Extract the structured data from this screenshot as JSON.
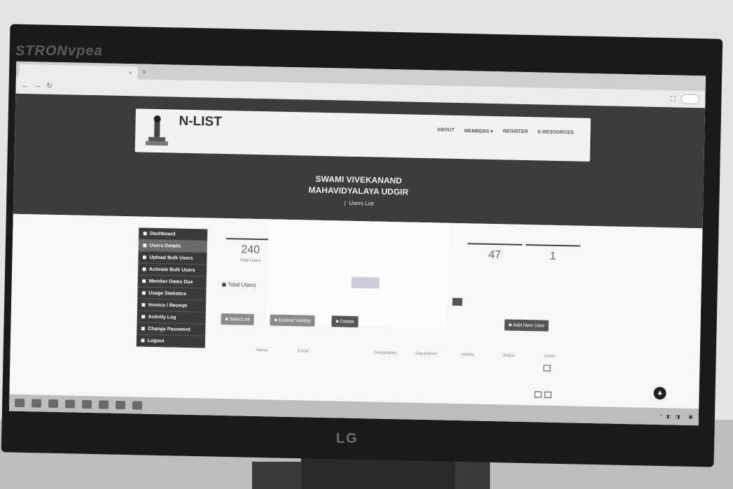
{
  "monitor": {
    "brand_label": "STRONvpea",
    "maker_label": "LG"
  },
  "browser": {
    "tab_title": "",
    "tab_close": "×",
    "new_tab": "+"
  },
  "site": {
    "brand": "N-LIST",
    "subtitle_lines": [
      "",
      "",
      ""
    ],
    "top_links": [
      "",
      "",
      "",
      "",
      ""
    ],
    "nav": [
      "",
      "ABOUT",
      "MEMBERS ▾",
      "REGISTER",
      "E-RESOURCES",
      ""
    ],
    "college_line1": "SWAMI VIVEKANAND",
    "college_line2": "MAHAVIDYALAYA UDGIR",
    "breadcrumb_home": "",
    "breadcrumb_sep": "|",
    "breadcrumb_current": "Users List"
  },
  "sidebar": {
    "items": [
      {
        "label": "Dashboard"
      },
      {
        "label": "Users Details"
      },
      {
        "label": "Upload Bulk Users"
      },
      {
        "label": "Activate Bulk Users"
      },
      {
        "label": "Member Dates Due"
      },
      {
        "label": "Usage Statistics"
      },
      {
        "label": "Invoice / Receipt"
      },
      {
        "label": "Activity Log"
      },
      {
        "label": "Change Password"
      },
      {
        "label": "Logout"
      }
    ]
  },
  "stats": {
    "total_users_value": "240",
    "total_users_caption": "Total Users",
    "second_value": "47",
    "second_caption": "",
    "third_value": "1",
    "third_caption": ""
  },
  "filters": {
    "total_users_label": "Total Users",
    "search_label": ""
  },
  "actions": {
    "select_all": "Select All",
    "extend_validity": "Extend Validity",
    "delete": "Delete",
    "add_new_user": "Add New User"
  },
  "table": {
    "columns": [
      "Name",
      "Email",
      "",
      "Designation",
      "Department",
      "Validity",
      "Status",
      "Action"
    ]
  },
  "taskbar": {
    "time": "",
    "date": ""
  }
}
